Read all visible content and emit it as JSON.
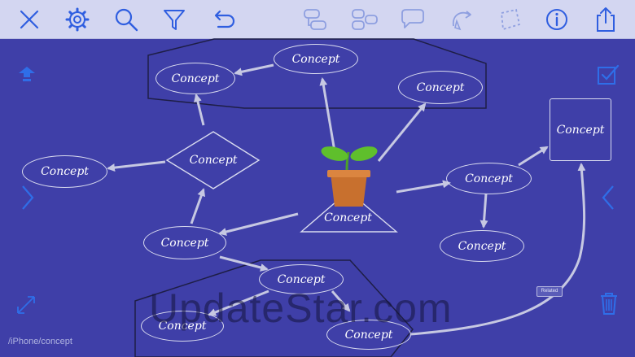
{
  "toolbar": {
    "buttons": [
      {
        "icon": "close-icon"
      },
      {
        "icon": "gear-icon"
      },
      {
        "icon": "search-icon"
      },
      {
        "icon": "filter-icon"
      },
      {
        "icon": "undo-icon"
      },
      {
        "icon": "add-child-node-icon"
      },
      {
        "icon": "add-sibling-node-icon"
      },
      {
        "icon": "callout-icon"
      },
      {
        "icon": "relation-icon"
      },
      {
        "icon": "boundary-icon"
      },
      {
        "icon": "info-icon"
      },
      {
        "icon": "share-icon"
      }
    ],
    "accent_color": "#2f5ee0",
    "muted_color": "#8e9fe0"
  },
  "map": {
    "background": "#3f3fa8",
    "nodes": {
      "top_left": "Concept",
      "top_center": "Concept",
      "top_right": "Concept",
      "left": "Concept",
      "diamond": "Concept",
      "center": "Concept",
      "right": "Concept",
      "far_right_box": "Concept",
      "right_bottom": "Concept",
      "lower_left": "Concept",
      "bottom_top": "Concept",
      "bottom_left": "Concept",
      "bottom_right": "Concept"
    },
    "relation_label": "Related"
  },
  "side_icons": [
    "outline-icon",
    "checklist-icon",
    "left-panel-chevron-icon",
    "right-panel-chevron-icon",
    "fullscreen-icon",
    "trash-icon"
  ],
  "path_label": "/iPhone/concept",
  "watermark": "UpdateStar.com"
}
